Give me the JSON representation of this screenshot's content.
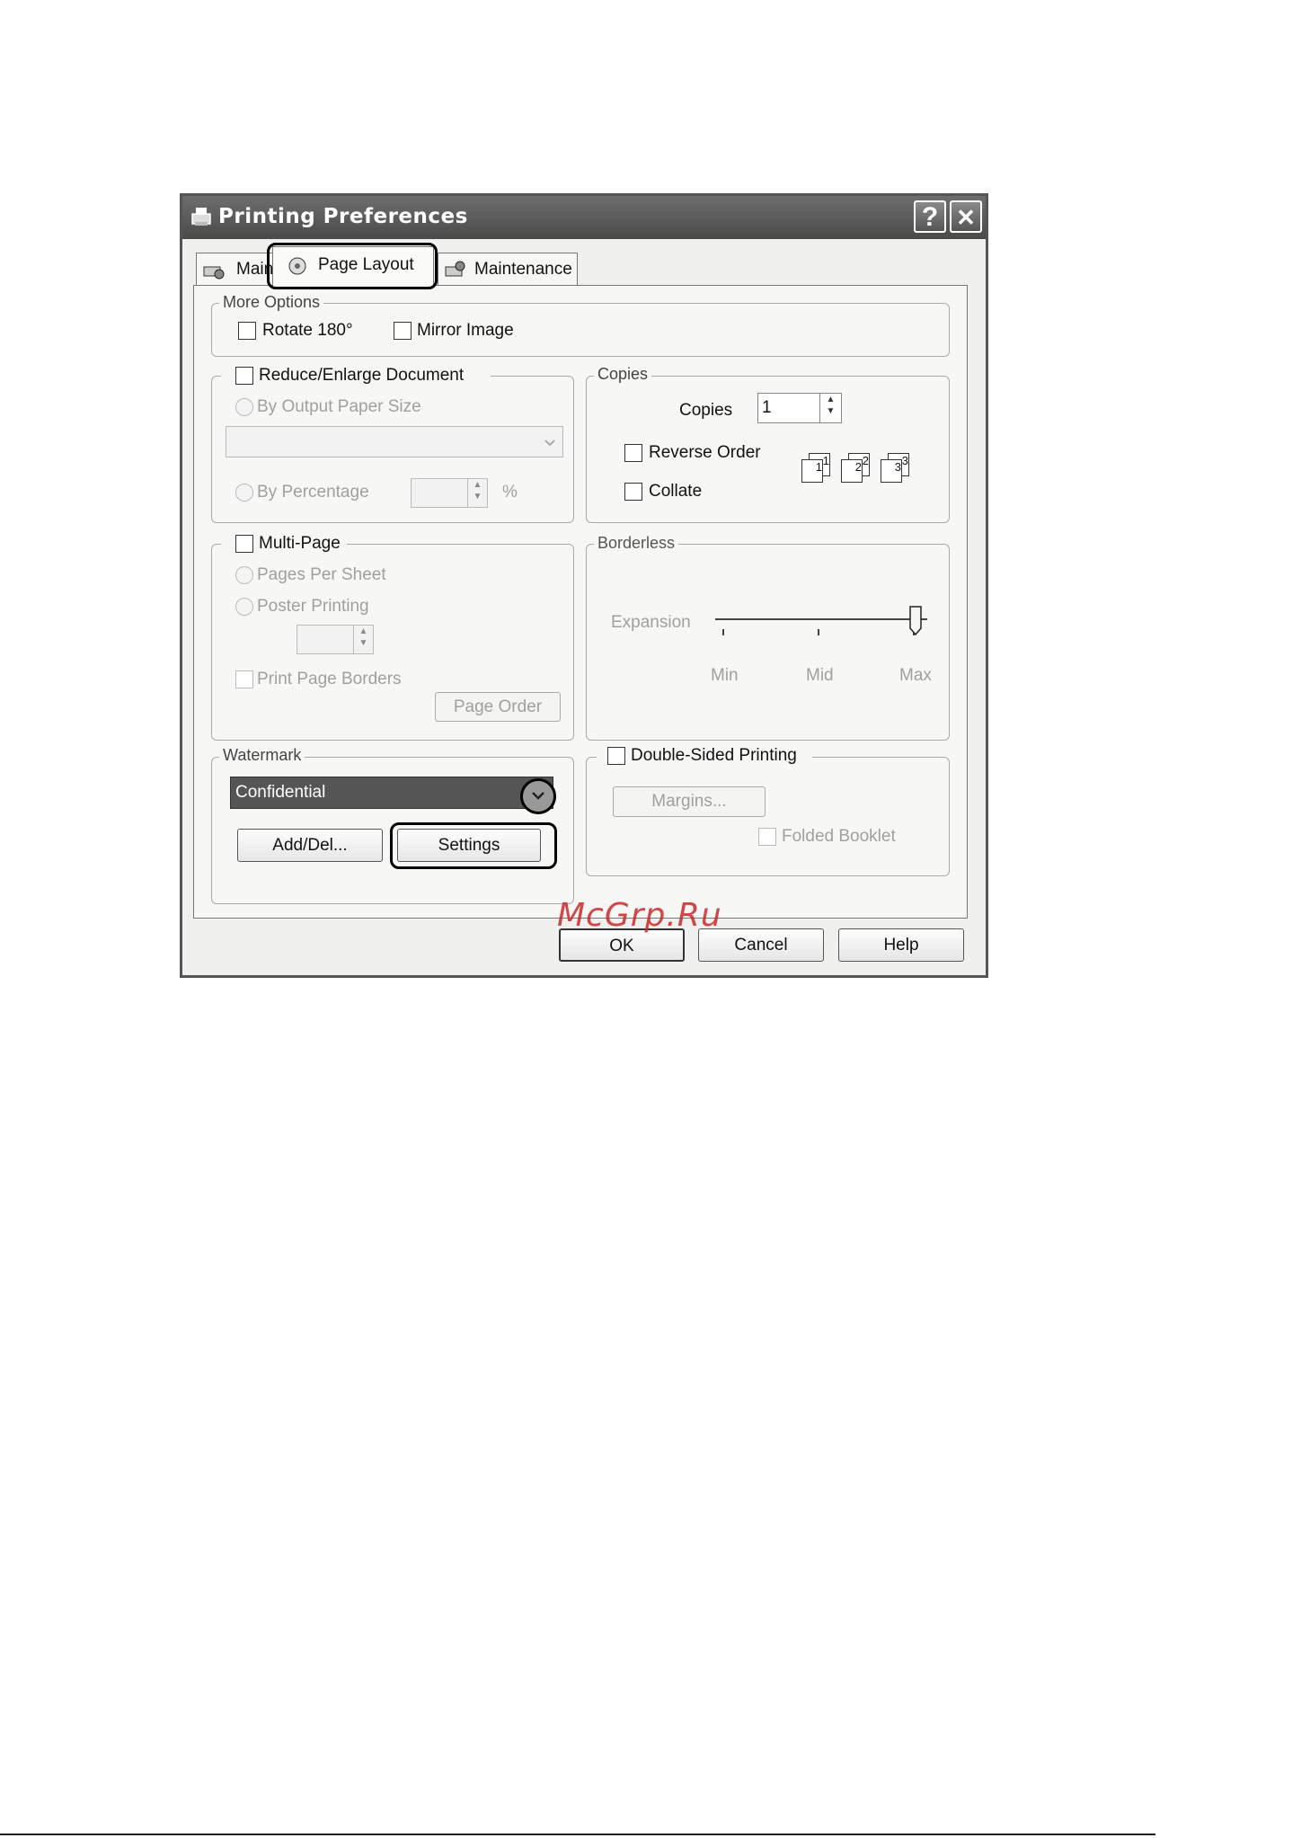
{
  "dialog": {
    "title": "Printing Preferences",
    "help_glyph": "?",
    "close_glyph": "✕"
  },
  "tabs": [
    {
      "label": "Main"
    },
    {
      "label": "Page Layout"
    },
    {
      "label": "Maintenance"
    }
  ],
  "more_options": {
    "label": "More Options",
    "rotate": "Rotate 180°",
    "mirror": "Mirror Image"
  },
  "reduce": {
    "label": "Reduce/Enlarge Document",
    "by_output": "By Output Paper Size",
    "by_percentage": "By Percentage",
    "percent_unit": "%"
  },
  "copies": {
    "group_label": "Copies",
    "label": "Copies",
    "value": "1",
    "reverse_order": "Reverse Order",
    "collate": "Collate",
    "collate_icons": [
      "1",
      "2",
      "3"
    ]
  },
  "multipage": {
    "label": "Multi-Page",
    "pages_per_sheet": "Pages Per Sheet",
    "poster": "Poster Printing",
    "print_borders": "Print Page Borders",
    "page_order": "Page Order"
  },
  "borderless": {
    "label": "Borderless",
    "expansion": "Expansion",
    "ticks": [
      "Min",
      "Mid",
      "Max"
    ],
    "slider_level": "Max"
  },
  "watermark": {
    "label": "Watermark",
    "selected": "Confidential",
    "add_del": "Add/Del...",
    "settings": "Settings"
  },
  "double_sided": {
    "label": "Double-Sided Printing",
    "margins": "Margins...",
    "folded_booklet": "Folded Booklet"
  },
  "buttons": {
    "ok": "OK",
    "cancel": "Cancel",
    "help": "Help"
  },
  "site_watermark": "McGrp.Ru"
}
